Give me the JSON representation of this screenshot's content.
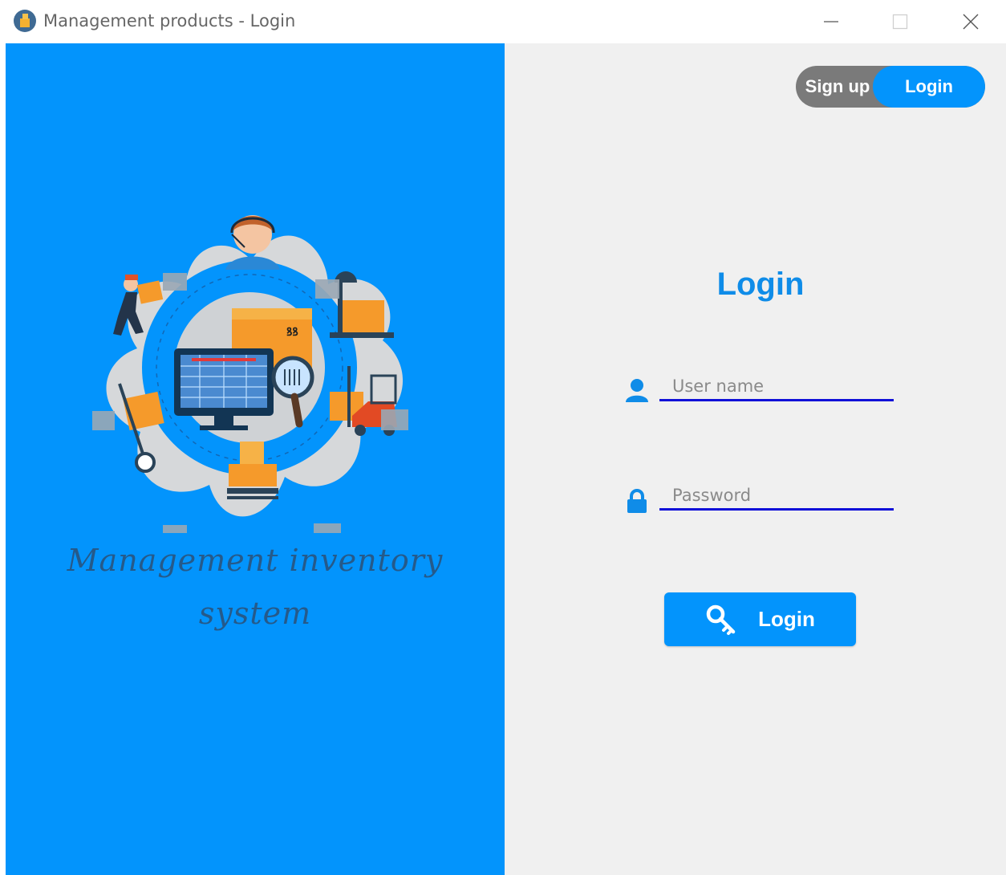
{
  "window": {
    "title": "Management products - Login",
    "app_icon": "inventory-app-icon",
    "controls": {
      "minimize": "minimize-icon",
      "maximize": "maximize-icon",
      "close": "close-icon"
    }
  },
  "brand": {
    "illustration": "inventory-management-illustration",
    "tagline_line1": "Management inventory",
    "tagline_line2": "system"
  },
  "toggle": {
    "signup_label": "Sign up",
    "login_label": "Login",
    "active": "Login"
  },
  "form": {
    "title": "Login",
    "username": {
      "placeholder": "User name",
      "value": "",
      "icon": "user-icon"
    },
    "password": {
      "placeholder": "Password",
      "value": "",
      "icon": "lock-icon"
    },
    "submit": {
      "label": "Login",
      "icon": "key-icon"
    }
  },
  "colors": {
    "accent": "#0394fc",
    "title_text": "#0f8ce8",
    "panel_bg": "#f0f0f0",
    "toggle_inactive": "#7a7a7a",
    "field_underline": "#1010d8",
    "tagline_text": "#255a8a"
  }
}
